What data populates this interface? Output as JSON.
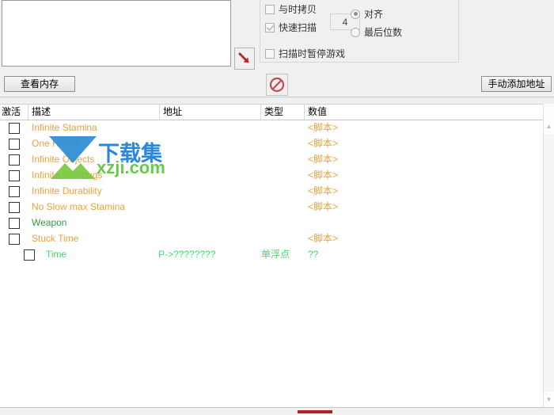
{
  "scan_options": {
    "panel_name": "scan-options",
    "copy_checkbox": {
      "label": "与时拷贝",
      "checked": false
    },
    "fast_scan_checkbox": {
      "label": "快速扫描",
      "checked": true
    },
    "fast_scan_value": "4",
    "align_radio": {
      "label": "对齐",
      "selected": true
    },
    "last_digits_radio": {
      "label": "最后位数",
      "selected": false
    },
    "pause_checkbox": {
      "label": "扫描时暂停游戏",
      "checked": false
    }
  },
  "toolbar": {
    "view_memory_label": "查看内存",
    "add_address_label": "手动添加地址",
    "stop_icon": "no-entry-icon",
    "arrow_icon": "red-down-right-arrow-icon"
  },
  "table": {
    "headers": {
      "active": "激活",
      "description": "描述",
      "address": "地址",
      "type": "类型",
      "value": "数值"
    },
    "rows": [
      {
        "checked": false,
        "indent": 0,
        "description": "Infinite Stamina",
        "address": "",
        "type": "",
        "value": "<脚本>",
        "color": "orange"
      },
      {
        "checked": false,
        "indent": 0,
        "description": "One Hit Kill",
        "address": "",
        "type": "",
        "value": "<脚本>",
        "color": "orange"
      },
      {
        "checked": false,
        "indent": 0,
        "description": "Infinite Objects",
        "address": "",
        "type": "",
        "value": "<脚本>",
        "color": "orange"
      },
      {
        "checked": false,
        "indent": 0,
        "description": "Infinite Wirebugs",
        "address": "",
        "type": "",
        "value": "<脚本>",
        "color": "orange"
      },
      {
        "checked": false,
        "indent": 0,
        "description": "Infinite Durability",
        "address": "",
        "type": "",
        "value": "<脚本>",
        "color": "orange"
      },
      {
        "checked": false,
        "indent": 0,
        "description": "No Slow max Stamina",
        "address": "",
        "type": "",
        "value": "<脚本>",
        "color": "orange"
      },
      {
        "checked": false,
        "indent": 0,
        "description": "Weapon",
        "address": "",
        "type": "",
        "value": "",
        "color": "green"
      },
      {
        "checked": false,
        "indent": 0,
        "description": "Stuck Time",
        "address": "",
        "type": "",
        "value": "<脚本>",
        "color": "orange"
      },
      {
        "checked": false,
        "indent": 1,
        "description": "Time",
        "address": "P->????????",
        "type": "单浮点",
        "value": "??",
        "color": "lgreen"
      }
    ]
  },
  "scrollbar": {
    "up_arrow": "▲",
    "down_arrow": "▼"
  },
  "watermark": {
    "text_cn": "下载集",
    "text_en": "xzji.com"
  },
  "colors": {
    "script_orange": "#e8a33d",
    "group_green": "#2f9c46",
    "entry_green": "#45d96a",
    "stop_red": "#c34a4f",
    "arrow_red": "#c0272d"
  }
}
